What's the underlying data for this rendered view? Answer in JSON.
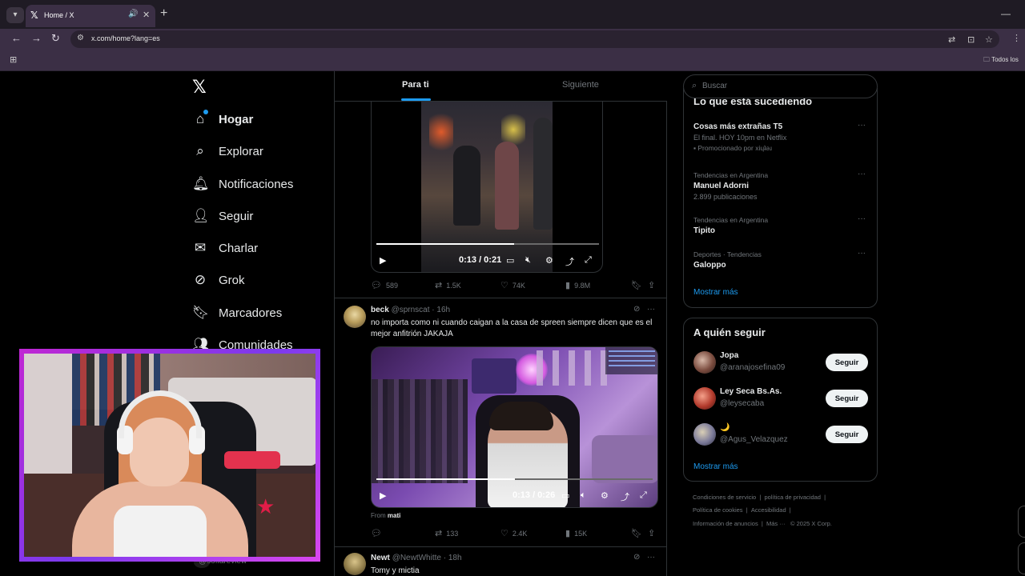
{
  "browser": {
    "tab_title": "Home / X",
    "url": "x.com/home?lang=es",
    "bookmarks_folder": "Todos los"
  },
  "nav": {
    "items": [
      {
        "label": "Hogar",
        "icon": "home-icon"
      },
      {
        "label": "Explorar",
        "icon": "search-icon"
      },
      {
        "label": "Notificaciones",
        "icon": "bell-icon"
      },
      {
        "label": "Seguir",
        "icon": "add-user-icon"
      },
      {
        "label": "Charlar",
        "icon": "mail-icon"
      },
      {
        "label": "Grok",
        "icon": "grok-icon"
      },
      {
        "label": "Marcadores",
        "icon": "bookmark-icon"
      },
      {
        "label": "Comunidades",
        "icon": "communities-icon"
      }
    ]
  },
  "feed": {
    "tabs": [
      "Para ti",
      "Siguiente"
    ],
    "video1": {
      "time": "0:13 / 0:21",
      "progress": 0.62
    },
    "tweet1_stats": {
      "replies": "589",
      "retweets": "1.5K",
      "likes": "74K",
      "views": "9.8M"
    },
    "tweet2": {
      "name": "beck",
      "handle": "@sprnscat · 16h",
      "text": "no importa como ni cuando caigan a la casa de spreen siempre dicen que es el mejor anfitrión JAKAJA",
      "video_time": "0:13 / 0:26",
      "progress": 0.5,
      "from_label": "From",
      "from_source": "mati",
      "stats": {
        "replies": "",
        "retweets": "133",
        "likes": "2.4K",
        "views": "15K"
      }
    },
    "tweet3": {
      "name": "Newt",
      "handle": "@NewtWhitte · 18h",
      "text": "Tomy y mictia"
    }
  },
  "right": {
    "search_placeholder": "Buscar",
    "trending_title": "Lo que está sucediendo",
    "trends": [
      {
        "context": "",
        "title": "Cosas más extrañas T5",
        "sub": "El final. HOY 10pm en Netflix",
        "promo": "Promocionado por xiɥʇǝɹ"
      },
      {
        "context": "Tendencias en Argentina",
        "title": "Manuel Adorni",
        "sub": "2.899 publicaciones"
      },
      {
        "context": "Tendencias en Argentina",
        "title": "Tipito",
        "sub": ""
      },
      {
        "context": "Deportes · Tendencias",
        "title": "Galoppo",
        "sub": ""
      }
    ],
    "show_more": "Mostrar más",
    "who_title": "A quién seguir",
    "who": [
      {
        "name": "Jopa",
        "handle": "@aranajosefina09",
        "button": "Seguir"
      },
      {
        "name": "Ley Seca Bs.As.",
        "handle": "@leysecaba",
        "button": "Seguir"
      },
      {
        "name": "🌙",
        "handle": "@Agus_Velazquez",
        "button": "Seguir"
      }
    ],
    "footer": {
      "line1": [
        "Condiciones de servicio",
        "|",
        "política de privacidad",
        "|"
      ],
      "line2": [
        "Política de cookies",
        "|",
        "Accesibilidad",
        "|"
      ],
      "line3": [
        "Información de anuncios",
        "|",
        "Más ···",
        "© 2025 X Corp."
      ]
    }
  },
  "overlay": {
    "caption": "@soflareview"
  }
}
